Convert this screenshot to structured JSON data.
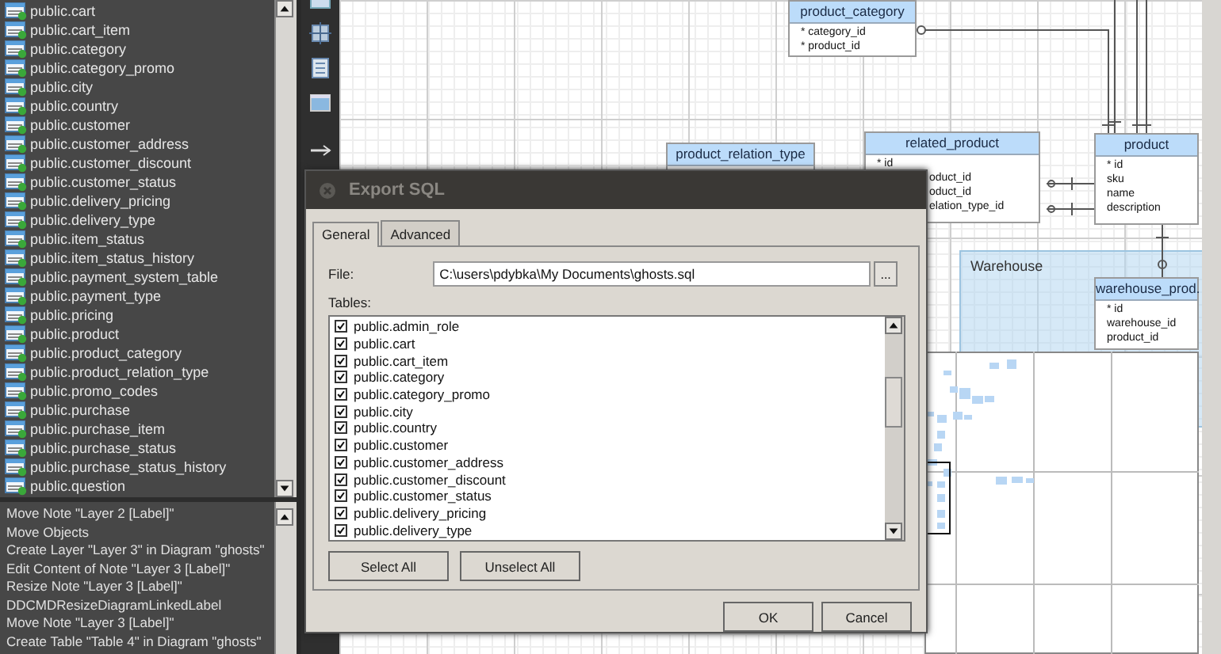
{
  "object_list": {
    "items": [
      "public.cart",
      "public.cart_item",
      "public.category",
      "public.category_promo",
      "public.city",
      "public.country",
      "public.customer",
      "public.customer_address",
      "public.customer_discount",
      "public.customer_status",
      "public.delivery_pricing",
      "public.delivery_type",
      "public.item_status",
      "public.item_status_history",
      "public.payment_system_table",
      "public.payment_type",
      "public.pricing",
      "public.product",
      "public.product_category",
      "public.product_relation_type",
      "public.promo_codes",
      "public.purchase",
      "public.purchase_item",
      "public.purchase_status",
      "public.purchase_status_history",
      "public.question"
    ]
  },
  "history": {
    "items": [
      "Move Note \"Layer 2 [Label]\"",
      "Move Objects",
      "Create Layer \"Layer 3\" in Diagram \"ghosts\"",
      "Edit Content of Note \"Layer 3 [Label]\"",
      "Resize Note \"Layer 3 [Label]\"",
      "DDCMDResizeDiagramLinkedLabel",
      "Move Note \"Layer 3 [Label]\"",
      "Create Table \"Table 4\" in Diagram \"ghosts\""
    ]
  },
  "diagram": {
    "areas": [
      {
        "label": "Warehouse"
      }
    ],
    "tables": [
      {
        "name": "product_category",
        "columns": [
          "* category_id",
          "* product_id"
        ]
      },
      {
        "name": "product_relation_type"
      },
      {
        "name": "related_product",
        "columns": [
          "* id",
          "oduct_id",
          "oduct_id",
          "elation_type_id"
        ]
      },
      {
        "name": "product",
        "columns": [
          "* id",
          "sku",
          "name",
          "description"
        ]
      },
      {
        "name": "warehouse_prod.",
        "columns": [
          "* id",
          "warehouse_id",
          "product_id"
        ]
      }
    ]
  },
  "dialog": {
    "title": "Export SQL",
    "tabs": [
      {
        "label": "General",
        "selected": true
      },
      {
        "label": "Advanced",
        "selected": false
      }
    ],
    "file_label": "File:",
    "file_value": "C:\\users\\pdybka\\My Documents\\ghosts.sql",
    "browse_button": "...",
    "tables_label": "Tables:",
    "tables": [
      {
        "name": "public.admin_role",
        "checked": true
      },
      {
        "name": "public.cart",
        "checked": true
      },
      {
        "name": "public.cart_item",
        "checked": true
      },
      {
        "name": "public.category",
        "checked": true
      },
      {
        "name": "public.category_promo",
        "checked": true
      },
      {
        "name": "public.city",
        "checked": true
      },
      {
        "name": "public.country",
        "checked": true
      },
      {
        "name": "public.customer",
        "checked": true
      },
      {
        "name": "public.customer_address",
        "checked": true
      },
      {
        "name": "public.customer_discount",
        "checked": true
      },
      {
        "name": "public.customer_status",
        "checked": true
      },
      {
        "name": "public.delivery_pricing",
        "checked": true
      },
      {
        "name": "public.delivery_type",
        "checked": true
      }
    ],
    "list_buttons": [
      "Select All",
      "Unselect All"
    ],
    "buttons": [
      "OK",
      "Cancel"
    ]
  }
}
